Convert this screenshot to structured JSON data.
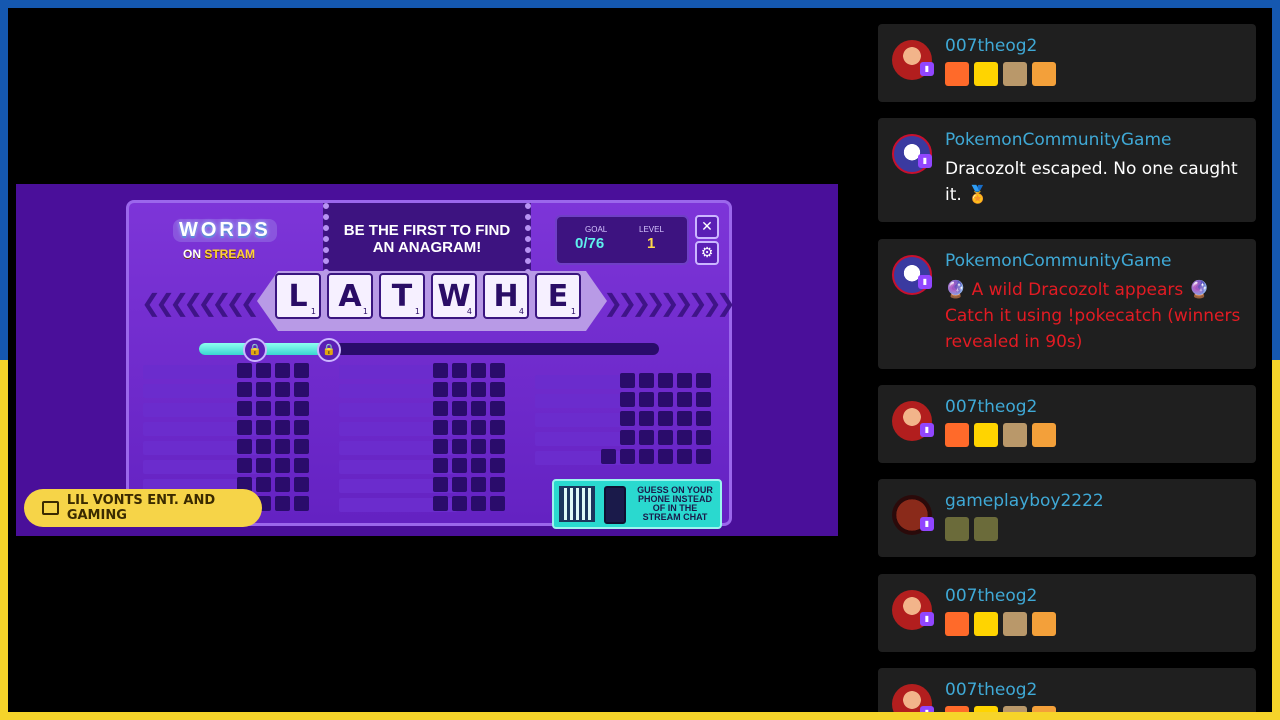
{
  "game": {
    "logo_top": "WORDS",
    "logo_on": "ON",
    "logo_stream": "STREAM",
    "prompt": "BE THE FIRST TO FIND AN ANAGRAM!",
    "goal_label": "GOAL",
    "goal_value": "0/76",
    "level_label": "LEVEL",
    "level_value": "1",
    "tiles": [
      {
        "letter": "L",
        "pts": "1"
      },
      {
        "letter": "A",
        "pts": "1"
      },
      {
        "letter": "T",
        "pts": "1"
      },
      {
        "letter": "W",
        "pts": "4"
      },
      {
        "letter": "H",
        "pts": "4"
      },
      {
        "letter": "E",
        "pts": "1"
      }
    ],
    "progress_fraction": 0.3,
    "qr_text": "GUESS ON YOUR PHONE INSTEAD OF IN THE STREAM CHAT",
    "channel_name": "LIL VONTS ENT. AND GAMING"
  },
  "chat": [
    {
      "username": "007theog2",
      "type": "emotes",
      "emotes": [
        "seven-emote",
        "bird-emote",
        "face-emote",
        "dog-emote"
      ]
    },
    {
      "username": "PokemonCommunityGame",
      "type": "text",
      "text": "Dracozolt escaped. No one caught it. 🏅"
    },
    {
      "username": "PokemonCommunityGame",
      "type": "red",
      "text": "🔮 A wild Dracozolt appears 🔮 Catch it using !pokecatch (winners revealed in 90s)"
    },
    {
      "username": "007theog2",
      "type": "emotes",
      "emotes": [
        "seven-emote",
        "bird-emote",
        "face-emote",
        "dog-emote"
      ]
    },
    {
      "username": "gameplayboy2222",
      "type": "emotes",
      "emotes": [
        "gulag-emote",
        "gulag-emote"
      ]
    },
    {
      "username": "007theog2",
      "type": "emotes",
      "emotes": [
        "seven-emote",
        "bird-emote",
        "face-emote",
        "dog-emote"
      ]
    },
    {
      "username": "007theog2",
      "type": "emotes",
      "emotes": [
        "seven-emote",
        "bird-emote",
        "face-emote",
        "dog-emote"
      ]
    }
  ],
  "colors": {
    "accent": "#9146ff",
    "username": "#3fa9d6",
    "alert": "#e31b23",
    "panel": "#1f1f1f"
  }
}
